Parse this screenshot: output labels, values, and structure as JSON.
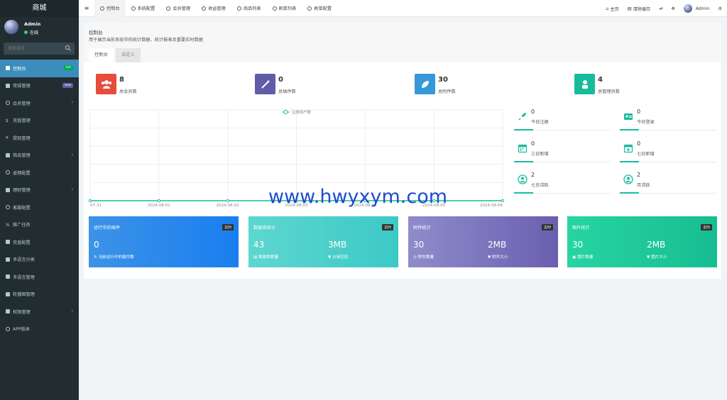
{
  "sidebar": {
    "logo": "商城",
    "user_name": "Admin",
    "user_status": "在线",
    "search_placeholder": "搜索菜单",
    "items": [
      {
        "label": "控制台",
        "badge": "hot",
        "badge_color": "#00a65a",
        "active": true
      },
      {
        "label": "常规管理",
        "badge": "new",
        "badge_color": "#605ca8"
      },
      {
        "label": "会员管理",
        "arrow": "‹"
      },
      {
        "label": "充值管理"
      },
      {
        "label": "提现管理"
      },
      {
        "label": "商品管理",
        "arrow": "‹"
      },
      {
        "label": "返佣配置"
      },
      {
        "label": "理财管理",
        "arrow": "‹"
      },
      {
        "label": "客服配置"
      },
      {
        "label": "推广任务"
      },
      {
        "label": "充值配置"
      },
      {
        "label": "多语言分类"
      },
      {
        "label": "多语言管理"
      },
      {
        "label": "轮播图管理"
      },
      {
        "label": "权限管理",
        "arrow": "‹"
      },
      {
        "label": "APP版本"
      }
    ]
  },
  "topbar": {
    "tabs": [
      "控制台",
      "系统配置",
      "会员管理",
      "收益管理",
      "商品列表",
      "刷单列表",
      "刷单配置"
    ],
    "home": "主页",
    "clear_cache": "清除缓存",
    "user": "Admin"
  },
  "header": {
    "title": "控制台",
    "desc": "用于展示当前系统中的统计数据、统计报表及重要实时数据",
    "subtabs": [
      "控制台",
      "自定义"
    ]
  },
  "stats": [
    {
      "value": "8",
      "label": "总会员数",
      "color": "#e74c3c"
    },
    {
      "value": "0",
      "label": "总插件数",
      "color": "#605ca8"
    },
    {
      "value": "30",
      "label": "总附件数",
      "color": "#3498db"
    },
    {
      "value": "4",
      "label": "总管理员数",
      "color": "#18bc9c"
    }
  ],
  "chart_data": {
    "type": "line",
    "series": [
      {
        "name": "注册用户数",
        "values": [
          0,
          0,
          0,
          0,
          0,
          0,
          0
        ]
      }
    ],
    "x": [
      "07-31",
      "2024-08-01",
      "2024-08-02",
      "2024-08-03",
      "2024-08-04",
      "2024-08-05",
      "2024-08-06"
    ],
    "color": "#18bc9c",
    "grid": true
  },
  "mini_stats": [
    {
      "value": "0",
      "label": "今日注册"
    },
    {
      "value": "0",
      "label": "今日登录"
    },
    {
      "value": "0",
      "label": "三日新增"
    },
    {
      "value": "0",
      "label": "七日新增"
    },
    {
      "value": "2",
      "label": "七日活跃"
    },
    {
      "value": "2",
      "label": "月活跃"
    }
  ],
  "cards": [
    {
      "title": "运行中的插件",
      "badge": "实时",
      "values": [
        {
          "value": "0",
          "label": "当前运行中的插件数"
        }
      ]
    },
    {
      "title": "数据库统计",
      "badge": "实时",
      "values": [
        {
          "value": "43",
          "label": "数据表数量"
        },
        {
          "value": "3MB",
          "label": "占用空间"
        }
      ]
    },
    {
      "title": "附件统计",
      "badge": "实时",
      "values": [
        {
          "value": "30",
          "label": "附件数量"
        },
        {
          "value": "2MB",
          "label": "附件大小"
        }
      ]
    },
    {
      "title": "图片统计",
      "badge": "实时",
      "values": [
        {
          "value": "30",
          "label": "图片数量"
        },
        {
          "value": "2MB",
          "label": "图片大小"
        }
      ]
    }
  ],
  "watermark": "www.hwyxym.com"
}
